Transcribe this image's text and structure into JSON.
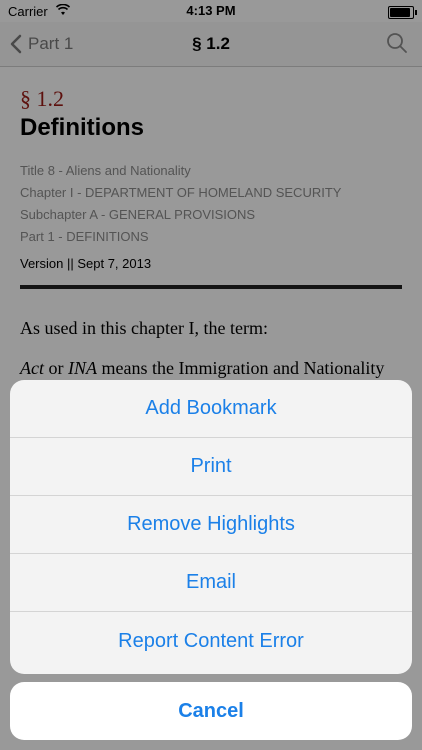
{
  "status_bar": {
    "carrier": "Carrier",
    "time": "4:13 PM",
    "icons": [
      "wifi-icon",
      "battery-icon"
    ]
  },
  "nav": {
    "back_label": "Part 1",
    "title": "§ 1.2",
    "icons": [
      "chevron-left-icon",
      "search-icon"
    ]
  },
  "document": {
    "section_number": "§ 1.2",
    "section_title": "Definitions",
    "meta": [
      "Title 8 - Aliens and Nationality",
      "Chapter I - DEPARTMENT OF HOMELAND SECURITY",
      "Subchapter A - GENERAL PROVISIONS",
      "Part 1 - DEFINITIONS"
    ],
    "version": "Version || Sept 7, 2013",
    "intro": "As used in this chapter I, the term:",
    "definition_italic_1": "Act",
    "definition_conj": " or ",
    "definition_italic_2": "INA",
    "definition_rest": " means the Immigration and Nationality Act, as amended."
  },
  "action_sheet": {
    "items": [
      "Add Bookmark",
      "Print",
      "Remove Highlights",
      "Email",
      "Report Content Error"
    ],
    "cancel": "Cancel"
  },
  "colors": {
    "accent": "#1b80e8",
    "section_number": "#9b1b17"
  }
}
